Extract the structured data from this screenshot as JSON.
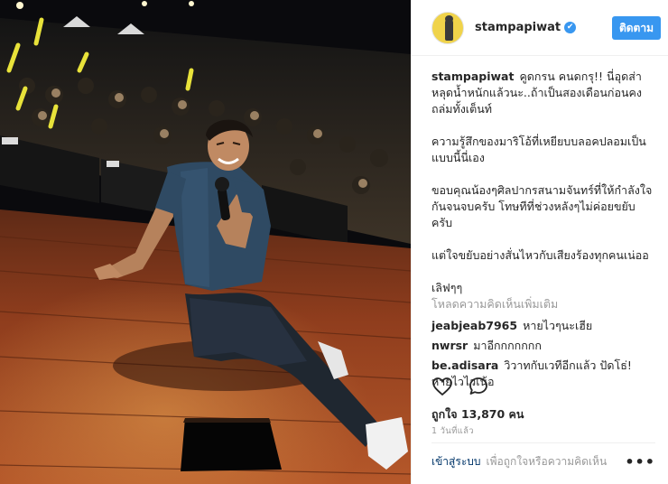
{
  "header": {
    "username": "stampapiwat",
    "verified_mark": "✔",
    "follow_label": "ติดตาม"
  },
  "caption": {
    "user": "stampapiwat",
    "lines": [
      "คูดกรน คนดกรุ!! นี่อุดส่าหลุดน้ำหนักแล้วนะ..ถ้าเป็นสองเดือนก่อนคงถล่มทั้งเต็นท์",
      "ความรู้สึกของมาริโอ้ที่เหยียบบลอคปลอมเป็นแบบนี้นี่เอง",
      "ขอบคุณน้องๆศิลปากรสนามจันทร์ที่ให้กำลังใจกันจนจบครับ โทษทีที่ช่วงหลังๆไม่ค่อยขยับครับ",
      "แต่ใจขยับอย่างสั่นไหวกับเสียงร้องทุกคนเน่ออ",
      "เลิฟๆๆ"
    ]
  },
  "load_more": "โหลดความคิดเห็นเพิ่มเติม",
  "comments": [
    {
      "user": "jeabjeab7965",
      "text": "หายไวๆนะเฮีย"
    },
    {
      "user": "nwrsr",
      "text": "มาอีกกกกกกก"
    },
    {
      "user": "be.adisara",
      "text": "วิวาทกับเวทีอีกแล้ว ปัดโธ่! หายไวไวเน้อ"
    }
  ],
  "likes": {
    "label": "ถูกใจ",
    "count": "13,870",
    "unit": "คน"
  },
  "timestamp": "1 วันที่แล้ว",
  "footer": {
    "login_label": "เข้าสู่ระบบ",
    "login_hint": "เพื่อถูกใจหรือความคิดเห็น",
    "more_label": "•••"
  },
  "icons": {
    "like": "heart-icon",
    "comment": "comment-bubble-icon",
    "more": "more-options-icon",
    "verified": "verified-badge-icon"
  },
  "colors": {
    "accent": "#3897f0",
    "link": "#003569",
    "muted": "#999999",
    "stage": "#8a3a1c"
  }
}
